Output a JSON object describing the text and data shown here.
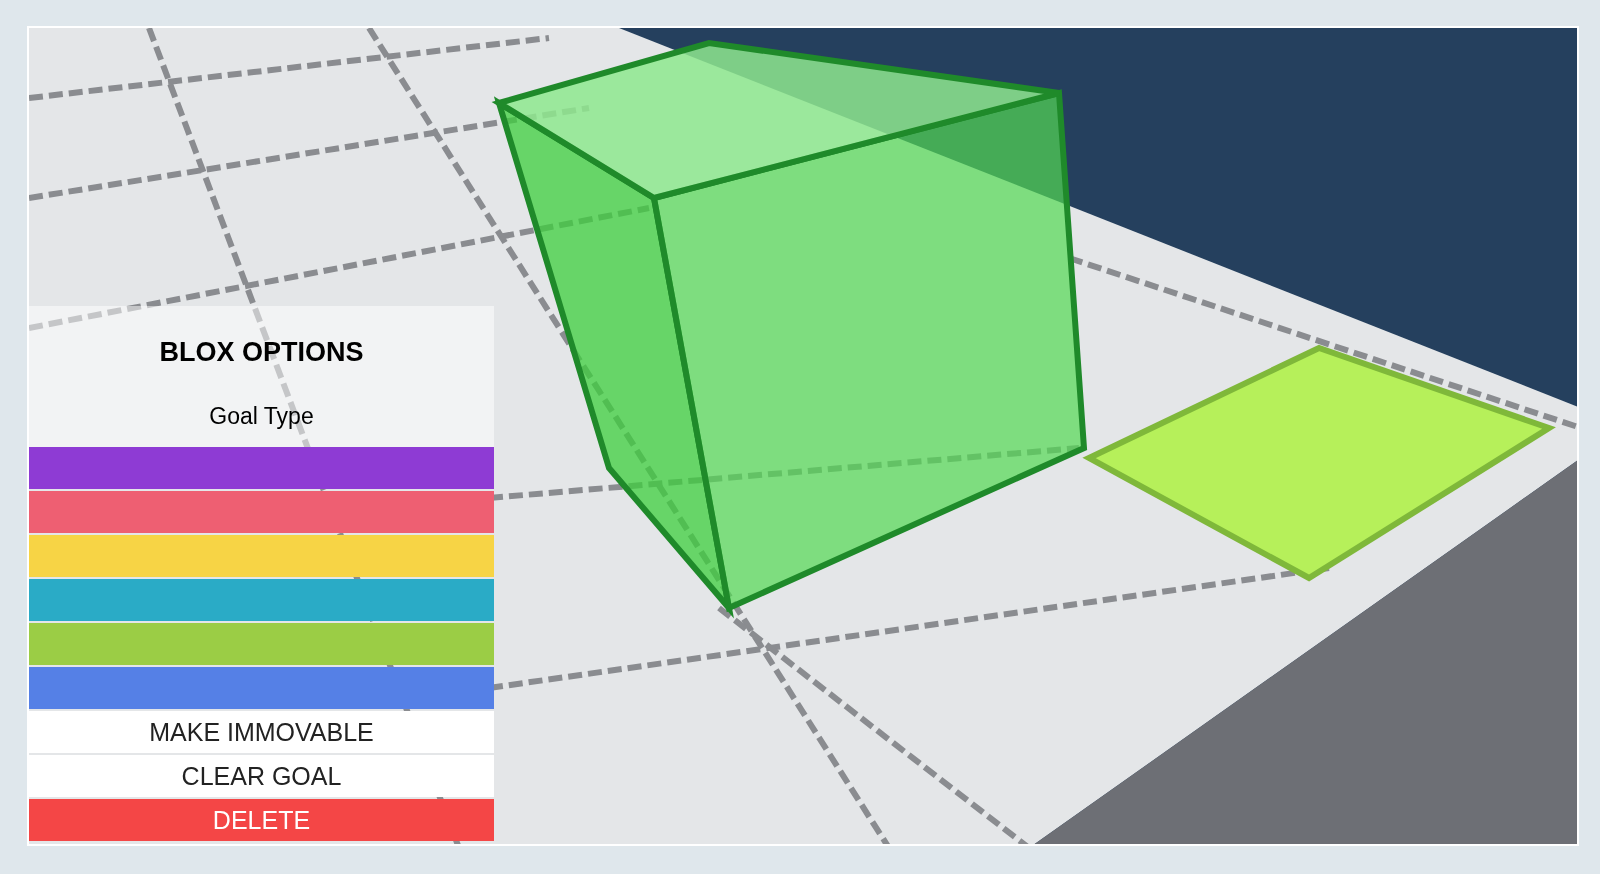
{
  "panel": {
    "title": "BLOX OPTIONS",
    "subtitle": "Goal Type",
    "goal_colors": [
      {
        "color": "#8e3bd4"
      },
      {
        "color": "#ee5f72"
      },
      {
        "color": "#f7d445"
      },
      {
        "color": "#2aabc6"
      },
      {
        "color": "#9bcd45"
      },
      {
        "color": "#5580e6"
      }
    ],
    "actions": [
      {
        "label": "MAKE IMMOVABLE",
        "kind": "plain"
      },
      {
        "label": "CLEAR GOAL",
        "kind": "plain"
      },
      {
        "label": "DELETE",
        "kind": "danger"
      }
    ]
  }
}
